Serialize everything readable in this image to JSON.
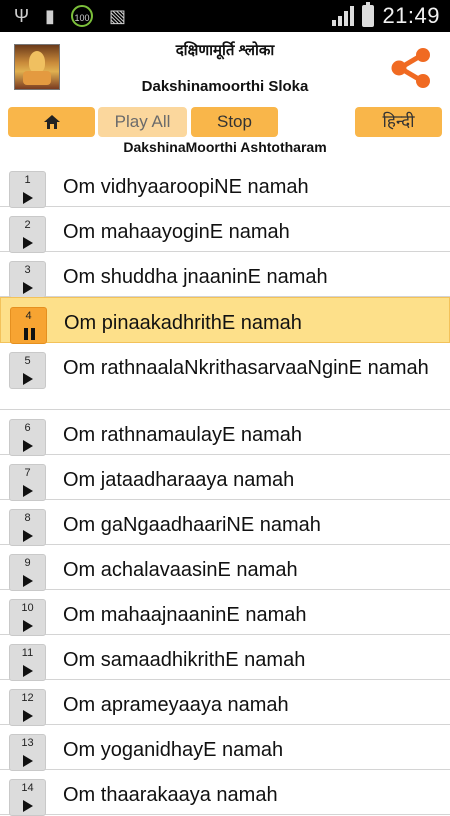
{
  "status_bar": {
    "time": "21:49",
    "battery_badge": "100",
    "icons": [
      "usb-icon",
      "sd-card-icon",
      "battery-100-icon",
      "sim-off-icon",
      "signal-icon",
      "battery-icon"
    ]
  },
  "header": {
    "title_hindi": "दक्षिणामूर्ति श्लोका",
    "title_english": "Dakshinamoorthi Sloka",
    "share_color": "#f06a22"
  },
  "toolbar": {
    "play_all": "Play All",
    "stop": "Stop",
    "language": "हिन्दी",
    "subtitle": "DakshinaMoorthi Ashtotharam"
  },
  "colors": {
    "button": "#f9b64a",
    "active_row": "#fde08a",
    "active_num": "#f7a432"
  },
  "list": [
    {
      "num": "1",
      "text": "Om vidhyaaroopiNE namah",
      "state": "play"
    },
    {
      "num": "2",
      "text": "Om mahaayoginE namah",
      "state": "play"
    },
    {
      "num": "3",
      "text": "Om shuddha jnaaninE namah",
      "state": "play"
    },
    {
      "num": "4",
      "text": "Om pinaakadhrithE namah",
      "state": "pause"
    },
    {
      "num": "5",
      "text": "Om rathnaalaNkrithasarvaaNginE namah",
      "state": "play"
    },
    {
      "num": "6",
      "text": "Om rathnamaulayE namah",
      "state": "play"
    },
    {
      "num": "7",
      "text": "Om jataadharaaya namah",
      "state": "play"
    },
    {
      "num": "8",
      "text": "Om gaNgaadhaariNE namah",
      "state": "play"
    },
    {
      "num": "9",
      "text": "Om achalavaasinE namah",
      "state": "play"
    },
    {
      "num": "10",
      "text": "Om mahaajnaaninE namah",
      "state": "play"
    },
    {
      "num": "11",
      "text": "Om samaadhikrithE namah",
      "state": "play"
    },
    {
      "num": "12",
      "text": "Om aprameyaaya namah",
      "state": "play"
    },
    {
      "num": "13",
      "text": "Om yoganidhayE namah",
      "state": "play"
    },
    {
      "num": "14",
      "text": "Om thaarakaaya namah",
      "state": "play"
    }
  ]
}
